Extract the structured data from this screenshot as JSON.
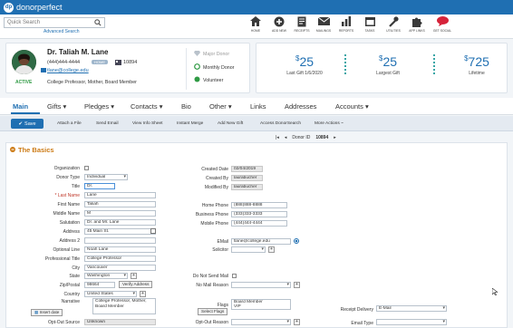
{
  "brand": {
    "logo_text": "donorperfect",
    "logo_glyph": "dp",
    "accent": "#1f6fb2"
  },
  "search": {
    "placeholder": "Quick Search",
    "advanced_link": "Advanced Search"
  },
  "nav": [
    {
      "label": "HOME",
      "icon": "home-icon"
    },
    {
      "label": "ADD NEW",
      "icon": "add-icon"
    },
    {
      "label": "RECEIPTS",
      "icon": "receipt-icon"
    },
    {
      "label": "MAILINGS",
      "icon": "mail-icon"
    },
    {
      "label": "REPORTS",
      "icon": "chart-icon"
    },
    {
      "label": "TASKS",
      "icon": "calendar-icon"
    },
    {
      "label": "UTILITIES",
      "icon": "wrench-icon"
    },
    {
      "label": "APP LINKS",
      "icon": "puzzle-icon"
    },
    {
      "label": "GET SOCIAL",
      "icon": "chat-icon"
    }
  ],
  "profile": {
    "name": "Dr. Taliah M. Lane",
    "phone": "(444)444-4444",
    "phone_badge": "HOME",
    "ext": "10894",
    "email": "tlane@college.edu",
    "roles": "College Professor, Mother, Board Member",
    "status": "ACTIVE",
    "tags": [
      "Major Donor",
      "Monthly Donor",
      "Volunteer"
    ]
  },
  "gifts": [
    {
      "amount": "25",
      "label": "Last Gift 1/6/2020"
    },
    {
      "amount": "25",
      "label": "Largest Gift"
    },
    {
      "amount": "725",
      "label": "Lifetime"
    }
  ],
  "tabs": [
    "Main",
    "Gifts",
    "Pledges",
    "Contacts",
    "Bio",
    "Other",
    "Links",
    "Addresses",
    "Accounts"
  ],
  "actions": {
    "save": "Save",
    "items": [
      "Attach a File",
      "Send Email",
      "View Info Sheet",
      "Instant Merge",
      "Add New Gift",
      "Access DonorSearch",
      "More Actions ~"
    ]
  },
  "donor_id": {
    "label": "Donor ID",
    "value": "10894"
  },
  "section": {
    "title": "The Basics"
  },
  "left_fields": [
    {
      "label": "Organization",
      "value": "",
      "kind": "check"
    },
    {
      "label": "Donor Type",
      "value": "Individual",
      "kind": "select"
    },
    {
      "label": "Title",
      "value": "Dr.",
      "kind": "text"
    },
    {
      "label": "* Last Name",
      "value": "Lane",
      "kind": "text"
    },
    {
      "label": "First Name",
      "value": "Taliah",
      "kind": "text"
    },
    {
      "label": "Middle Name",
      "value": "M",
      "kind": "text"
    },
    {
      "label": "Salutation",
      "value": "Dr. and Mr. Lane",
      "kind": "text"
    },
    {
      "label": "Address",
      "value": "45 Main St.",
      "kind": "text"
    },
    {
      "label": "Address 2",
      "value": "",
      "kind": "text"
    },
    {
      "label": "Optional Line",
      "value": "Noah Lane",
      "kind": "text"
    },
    {
      "label": "Professional Title",
      "value": "College Professor",
      "kind": "text"
    },
    {
      "label": "City",
      "value": "Vancouver",
      "kind": "text"
    },
    {
      "label": "State",
      "value": "Washington",
      "kind": "select"
    },
    {
      "label": "Zip/Postal",
      "value": "98664",
      "kind": "text"
    },
    {
      "label": "Country",
      "value": "United States",
      "kind": "select"
    }
  ],
  "verify_address": "Verify Address",
  "narrative": {
    "label": "Narrative",
    "value": "College Professor, Mother, Board Member",
    "insert": "Insert date"
  },
  "opt_out_source": {
    "label": "Opt-Out Source",
    "value": "Unknown"
  },
  "right_fields": [
    {
      "label": "Created Date",
      "value": "02/04/2019"
    },
    {
      "label": "Created By",
      "value": "laurabucher"
    },
    {
      "label": "Modified By",
      "value": "laurabucher"
    },
    {
      "label": "Home Phone",
      "value": "(888)888-8888"
    },
    {
      "label": "Business Phone",
      "value": "(333)333-3333"
    },
    {
      "label": "Mobile Phone",
      "value": "(444)444-4444"
    }
  ],
  "email_field": {
    "label": "EMail",
    "value": "tlane@college.edu"
  },
  "solicitor": {
    "label": "Solicitor",
    "value": ""
  },
  "do_not_send": {
    "label": "Do Not Send Mail"
  },
  "no_mail_reason": {
    "label": "No Mail Reason",
    "value": ""
  },
  "flags": {
    "label": "Flags",
    "values": [
      "Board Member",
      "VIP"
    ],
    "button": "Select Flags"
  },
  "opt_out_reason": {
    "label": "Opt-Out Reason",
    "value": ""
  },
  "receipt_delivery": {
    "label": "Receipt Delivery",
    "value": "E-Mail"
  },
  "email_type": {
    "label": "Email Type",
    "value": ""
  }
}
